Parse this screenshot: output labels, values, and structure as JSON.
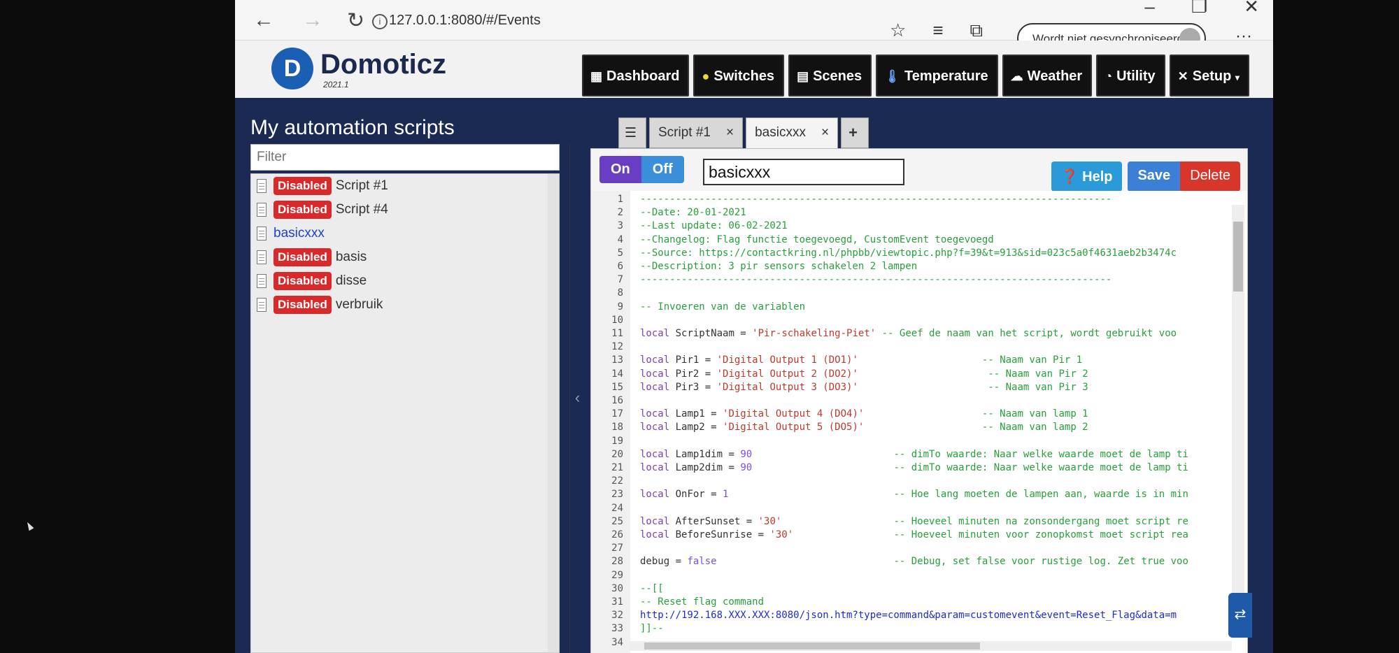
{
  "browser": {
    "url": "127.0.0.1:8080/#/Events",
    "sync_label": "Wordt niet gesynchroniseerd"
  },
  "app": {
    "name": "Domoticz",
    "version": "2021.1",
    "nav": [
      {
        "label": "Dashboard",
        "icon": "dashboard-icon"
      },
      {
        "label": "Switches",
        "icon": "bulb-icon"
      },
      {
        "label": "Scenes",
        "icon": "clapper-icon"
      },
      {
        "label": "Temperature",
        "icon": "thermometer-icon"
      },
      {
        "label": "Weather",
        "icon": "cloud-icon"
      },
      {
        "label": "Utility",
        "icon": "gauge-icon"
      },
      {
        "label": "Setup",
        "icon": "tools-icon"
      }
    ]
  },
  "sidebar": {
    "title": "My automation scripts",
    "filter_placeholder": "Filter",
    "scripts": [
      {
        "badge": "Disabled",
        "name": "Script #1"
      },
      {
        "badge": "Disabled",
        "name": "Script #4"
      },
      {
        "badge": "",
        "name": "basicxxx"
      },
      {
        "badge": "Disabled",
        "name": "basis"
      },
      {
        "badge": "Disabled",
        "name": "disse"
      },
      {
        "badge": "Disabled",
        "name": "verbruik"
      }
    ]
  },
  "tabs": [
    {
      "label": "Script #1",
      "close": "×"
    },
    {
      "label": "basicxxx",
      "close": "×"
    }
  ],
  "editor": {
    "on_label": "On",
    "off_label": "Off",
    "script_name": "basicxxx",
    "help_label": "Help",
    "save_label": "Save",
    "delete_label": "Delete",
    "lines": [
      {
        "n": "1",
        "t": "--------------------------------------------------------------------------------",
        "c": "comment"
      },
      {
        "n": "2",
        "t": "--Date: 20-01-2021",
        "c": "comment"
      },
      {
        "n": "3",
        "t": "--Last update: 06-02-2021",
        "c": "comment"
      },
      {
        "n": "4",
        "t": "--Changelog: Flag functie toegevoegd, CustomEvent toegevoegd",
        "c": "comment"
      },
      {
        "n": "5",
        "t": "--Source: https://contactkring.nl/phpbb/viewtopic.php?f=39&t=913&sid=023c5a0f4631aeb2b3474c",
        "c": "comment"
      },
      {
        "n": "6",
        "t": "--Description: 3 pir sensors schakelen 2 lampen",
        "c": "comment"
      },
      {
        "n": "7",
        "t": "--------------------------------------------------------------------------------",
        "c": "comment"
      },
      {
        "n": "8",
        "t": "",
        "c": "plain"
      },
      {
        "n": "9",
        "t": "-- Invoeren van de variablen",
        "c": "comment"
      },
      {
        "n": "10",
        "t": "",
        "c": "plain"
      },
      {
        "n": "11",
        "t": "local ScriptNaam = 'Pir-schakeling-Piet' -- Geef de naam van het script, wordt gebruikt voo",
        "c": "mixed"
      },
      {
        "n": "12",
        "t": "",
        "c": "plain"
      },
      {
        "n": "13",
        "t": "local Pir1 = 'Digital Output 1 (DO1)'                     -- Naam van Pir 1",
        "c": "mixed"
      },
      {
        "n": "14",
        "t": "local Pir2 = 'Digital Output 2 (DO2)'                      -- Naam van Pir 2",
        "c": "mixed"
      },
      {
        "n": "15",
        "t": "local Pir3 = 'Digital Output 3 (DO3)'                      -- Naam van Pir 3",
        "c": "mixed"
      },
      {
        "n": "16",
        "t": "",
        "c": "plain"
      },
      {
        "n": "17",
        "t": "local Lamp1 = 'Digital Output 4 (DO4)'                    -- Naam van lamp 1",
        "c": "mixed"
      },
      {
        "n": "18",
        "t": "local Lamp2 = 'Digital Output 5 (DO5)'                    -- Naam van lamp 2",
        "c": "mixed"
      },
      {
        "n": "19",
        "t": "",
        "c": "plain"
      },
      {
        "n": "20",
        "t": "local Lamp1dim = 90                        -- dimTo waarde: Naar welke waarde moet de lamp ti",
        "c": "mixed"
      },
      {
        "n": "21",
        "t": "local Lamp2dim = 90                        -- dimTo waarde: Naar welke waarde moet de lamp ti",
        "c": "mixed"
      },
      {
        "n": "22",
        "t": "",
        "c": "plain"
      },
      {
        "n": "23",
        "t": "local OnFor = 1                            -- Hoe lang moeten de lampen aan, waarde is in min",
        "c": "mixed"
      },
      {
        "n": "24",
        "t": "",
        "c": "plain"
      },
      {
        "n": "25",
        "t": "local AfterSunset = '30'                   -- Hoeveel minuten na zonsondergang moet script re",
        "c": "mixed"
      },
      {
        "n": "26",
        "t": "local BeforeSunrise = '30'                 -- Hoeveel minuten voor zonopkomst moet script rea",
        "c": "mixed"
      },
      {
        "n": "27",
        "t": "",
        "c": "plain"
      },
      {
        "n": "28",
        "t": "debug = false                              -- Debug, set false voor rustige log. Zet true voo",
        "c": "mixed"
      },
      {
        "n": "29",
        "t": "",
        "c": "plain"
      },
      {
        "n": "30",
        "t": "--[[",
        "c": "comment"
      },
      {
        "n": "31",
        "t": "-- Reset flag command",
        "c": "comment"
      },
      {
        "n": "32",
        "t": "http://192.168.XXX.XXX:8080/json.htm?type=command&param=customevent&event=Reset_Flag&data=m",
        "c": "url"
      },
      {
        "n": "33",
        "t": "]]--",
        "c": "comment"
      },
      {
        "n": "34",
        "t": "",
        "c": "plain"
      }
    ]
  }
}
